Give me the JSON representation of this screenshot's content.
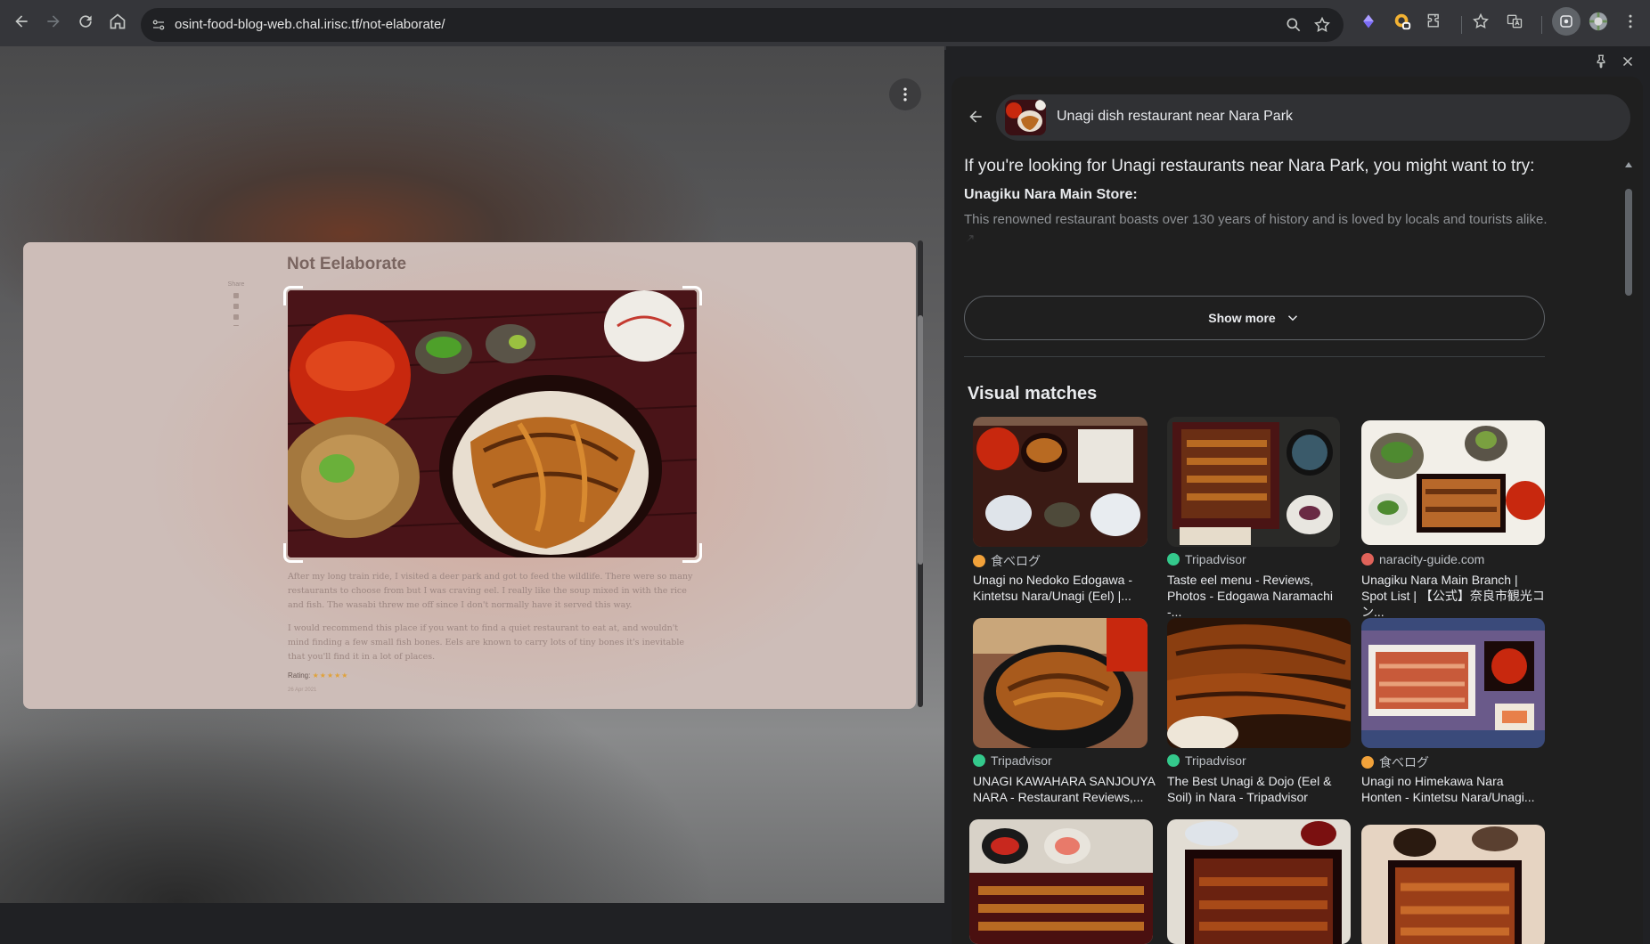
{
  "toolbar": {
    "url": "osint-food-blog-web.chal.irisc.tf/not-elaborate/",
    "icons": [
      "back-icon",
      "forward-icon",
      "reload-icon",
      "home-icon",
      "site-info-icon",
      "zoom-icon",
      "bookmark-star-icon",
      "extension-gem-icon",
      "extension-badge-icon",
      "extensions-puzzle-icon",
      "bookmarks-icon",
      "translate-icon",
      "lens-icon",
      "profile-avatar"
    ]
  },
  "page": {
    "blog_title": "Not Eelaborate",
    "share_label": "Share",
    "paragraph_1": "After my long train ride, I visited a deer park and got to feed the wildlife. There were so many restaurants to choose from but I was craving eel. I really like the soup mixed in with the rice and fish. The wasabi threw me off since I don't normally have it served this way.",
    "paragraph_2": "I would recommend this place if you want to find a quiet restaurant to eat at, and wouldn't mind finding a few small fish bones. Eels are known to carry lots of tiny bones it's inevitable that you'll find it in a lot of places.",
    "rating_label": "Rating:",
    "rating_stars": "★★★★★",
    "date": "26 Apr 2021"
  },
  "panel": {
    "search_query": "Unagi dish restaurant near Nara Park",
    "ai_lead": "If you're looking for Unagi restaurants near Nara Park, you might want to try:",
    "ai_sub": "Unagiku Nara Main Store:",
    "ai_fade": "This renowned restaurant boasts over 130 years of history and is loved by locals and tourists alike. ↗",
    "show_more": "Show more",
    "visual_matches_title": "Visual matches",
    "matches": [
      {
        "source": "食べログ",
        "title": "Unagi no Nedoko Edogawa - Kintetsu Nara/Unagi (Eel) |...",
        "fav_color": "#f2a23a"
      },
      {
        "source": "Tripadvisor",
        "title": "Taste eel menu - Reviews, Photos - Edogawa Naramachi -...",
        "fav_color": "#34c98c"
      },
      {
        "source": "naracity-guide.com",
        "title": "Unagiku Nara Main Branch | Spot List | 【公式】奈良市観光コン...",
        "fav_color": "#e0635a"
      },
      {
        "source": "Tripadvisor",
        "title": "UNAGI KAWAHARA SANJOUYA NARA - Restaurant Reviews,...",
        "fav_color": "#34c98c"
      },
      {
        "source": "Tripadvisor",
        "title": "The Best Unagi & Dojo (Eel & Soil) in Nara - Tripadvisor",
        "fav_color": "#34c98c"
      },
      {
        "source": "食べログ",
        "title": "Unagi no Himekawa Nara Honten - Kintetsu Nara/Unagi...",
        "fav_color": "#f2a23a"
      }
    ]
  }
}
